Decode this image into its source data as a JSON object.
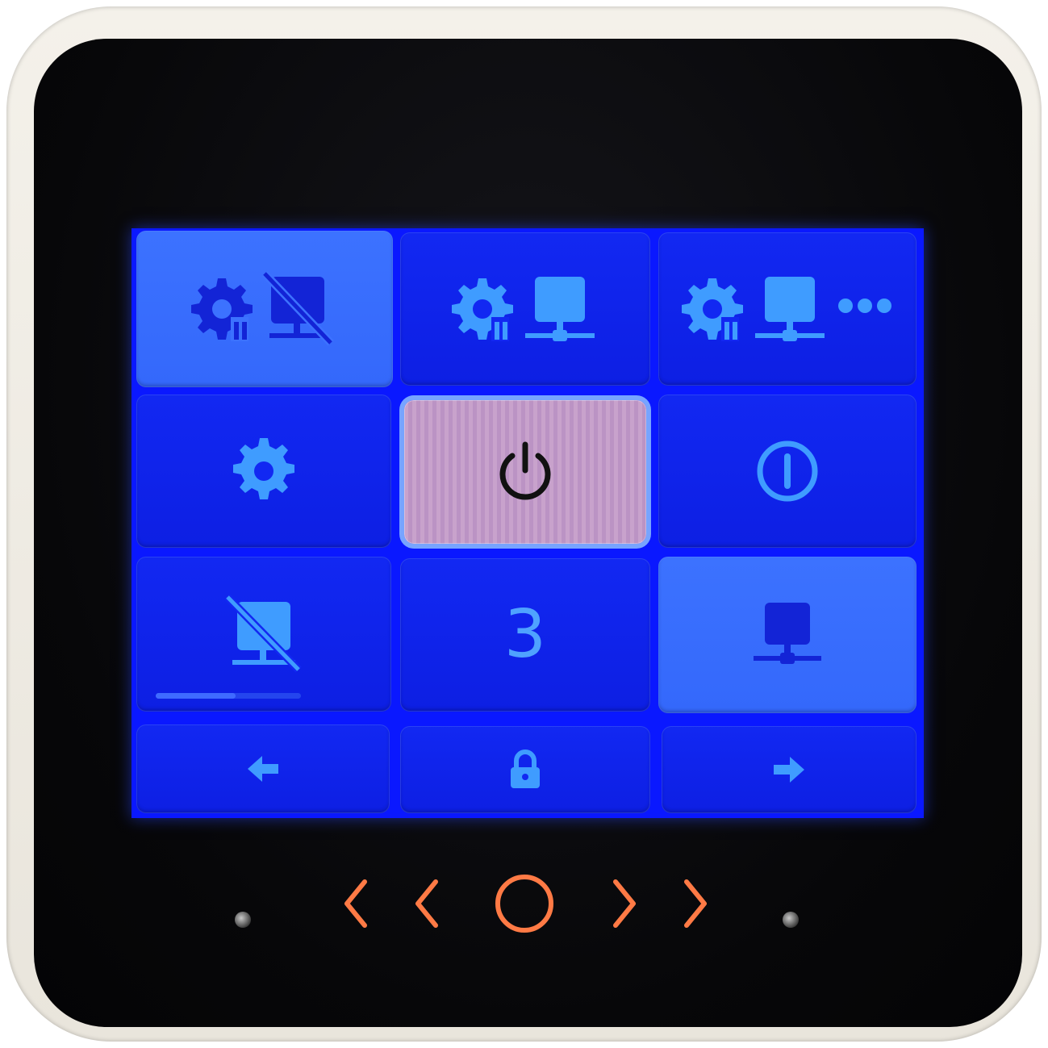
{
  "device": {
    "screen_background": "#0a18ff",
    "accent_icon_color": "#3f9cff",
    "active_tile_color": "#3c72ff",
    "selected_tile_color": "#c8a2cc",
    "touch_key_color": "#ff7a45"
  },
  "grid": {
    "tiles": [
      {
        "icons": [
          "gear-pause-icon",
          "monitor-network-off-icon"
        ],
        "state": "active"
      },
      {
        "icons": [
          "gear-pause-icon",
          "monitor-network-icon"
        ],
        "state": "normal"
      },
      {
        "icons": [
          "gear-pause-icon",
          "monitor-network-icon",
          "more-dots-icon"
        ],
        "state": "normal"
      },
      {
        "icons": [
          "gear-icon"
        ],
        "state": "normal"
      },
      {
        "icons": [
          "power-icon"
        ],
        "state": "selected"
      },
      {
        "icons": [
          "power-on-off-icon"
        ],
        "state": "normal"
      },
      {
        "icons": [
          "monitor-network-off-icon"
        ],
        "state": "normal",
        "progress": 0.55
      },
      {
        "label": "3",
        "state": "normal"
      },
      {
        "icons": [
          "monitor-network-icon"
        ],
        "state": "active"
      }
    ]
  },
  "bottom_bar": {
    "left": "arrow-left-icon",
    "center": "lock-icon",
    "right": "arrow-right-icon"
  },
  "touch_keys": [
    "chevron-left-icon",
    "chevron-left-icon",
    "circle-icon",
    "chevron-right-icon",
    "chevron-right-icon"
  ]
}
